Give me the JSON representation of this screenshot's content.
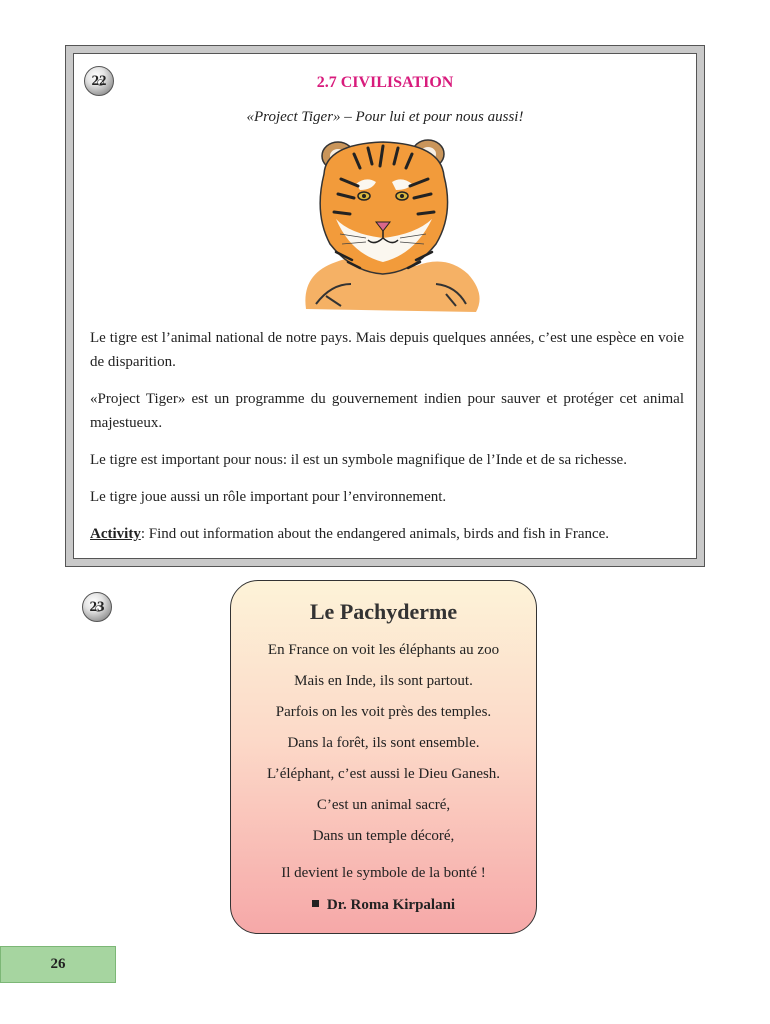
{
  "civilisation": {
    "badge": "22",
    "title": "2.7 CIVILISATION",
    "subtitle": "«Project Tiger» – Pour lui et pour nous aussi!",
    "image_icon": "tiger-illustration",
    "paragraphs": [
      "Le tigre est l’animal national de notre pays. Mais depuis quelques années, c’est une espèce en voie de disparition.",
      "«Project Tiger» est un programme du gouvernement indien pour sauver et protéger cet animal majestueux.",
      "Le tigre est important pour nous: il est un symbole magnifique de l’Inde et de sa richesse.",
      "Le tigre joue aussi un rôle important pour l’environnement."
    ],
    "activity_label": "Activity",
    "activity_text": ": Find out information about the endangered animals, birds and fish in France."
  },
  "poem": {
    "badge": "23",
    "title": "Le Pachyderme",
    "lines": [
      "En France on voit les éléphants au zoo",
      "Mais en Inde, ils sont partout.",
      "Parfois on les voit près des temples.",
      "Dans la forêt, ils sont ensemble.",
      "L’éléphant, c’est aussi le Dieu Ganesh.",
      "C’est un animal sacré,",
      "Dans un temple décoré,",
      "Il devient le symbole de la bonté !"
    ],
    "author": "Dr. Roma Kirpalani"
  },
  "page_number": "26",
  "colors": {
    "title_accent": "#d81b7c",
    "page_tab": "#a6d5a0",
    "poem_gradient_top": "#fdf3d8",
    "poem_gradient_bottom": "#f6a8a8"
  }
}
